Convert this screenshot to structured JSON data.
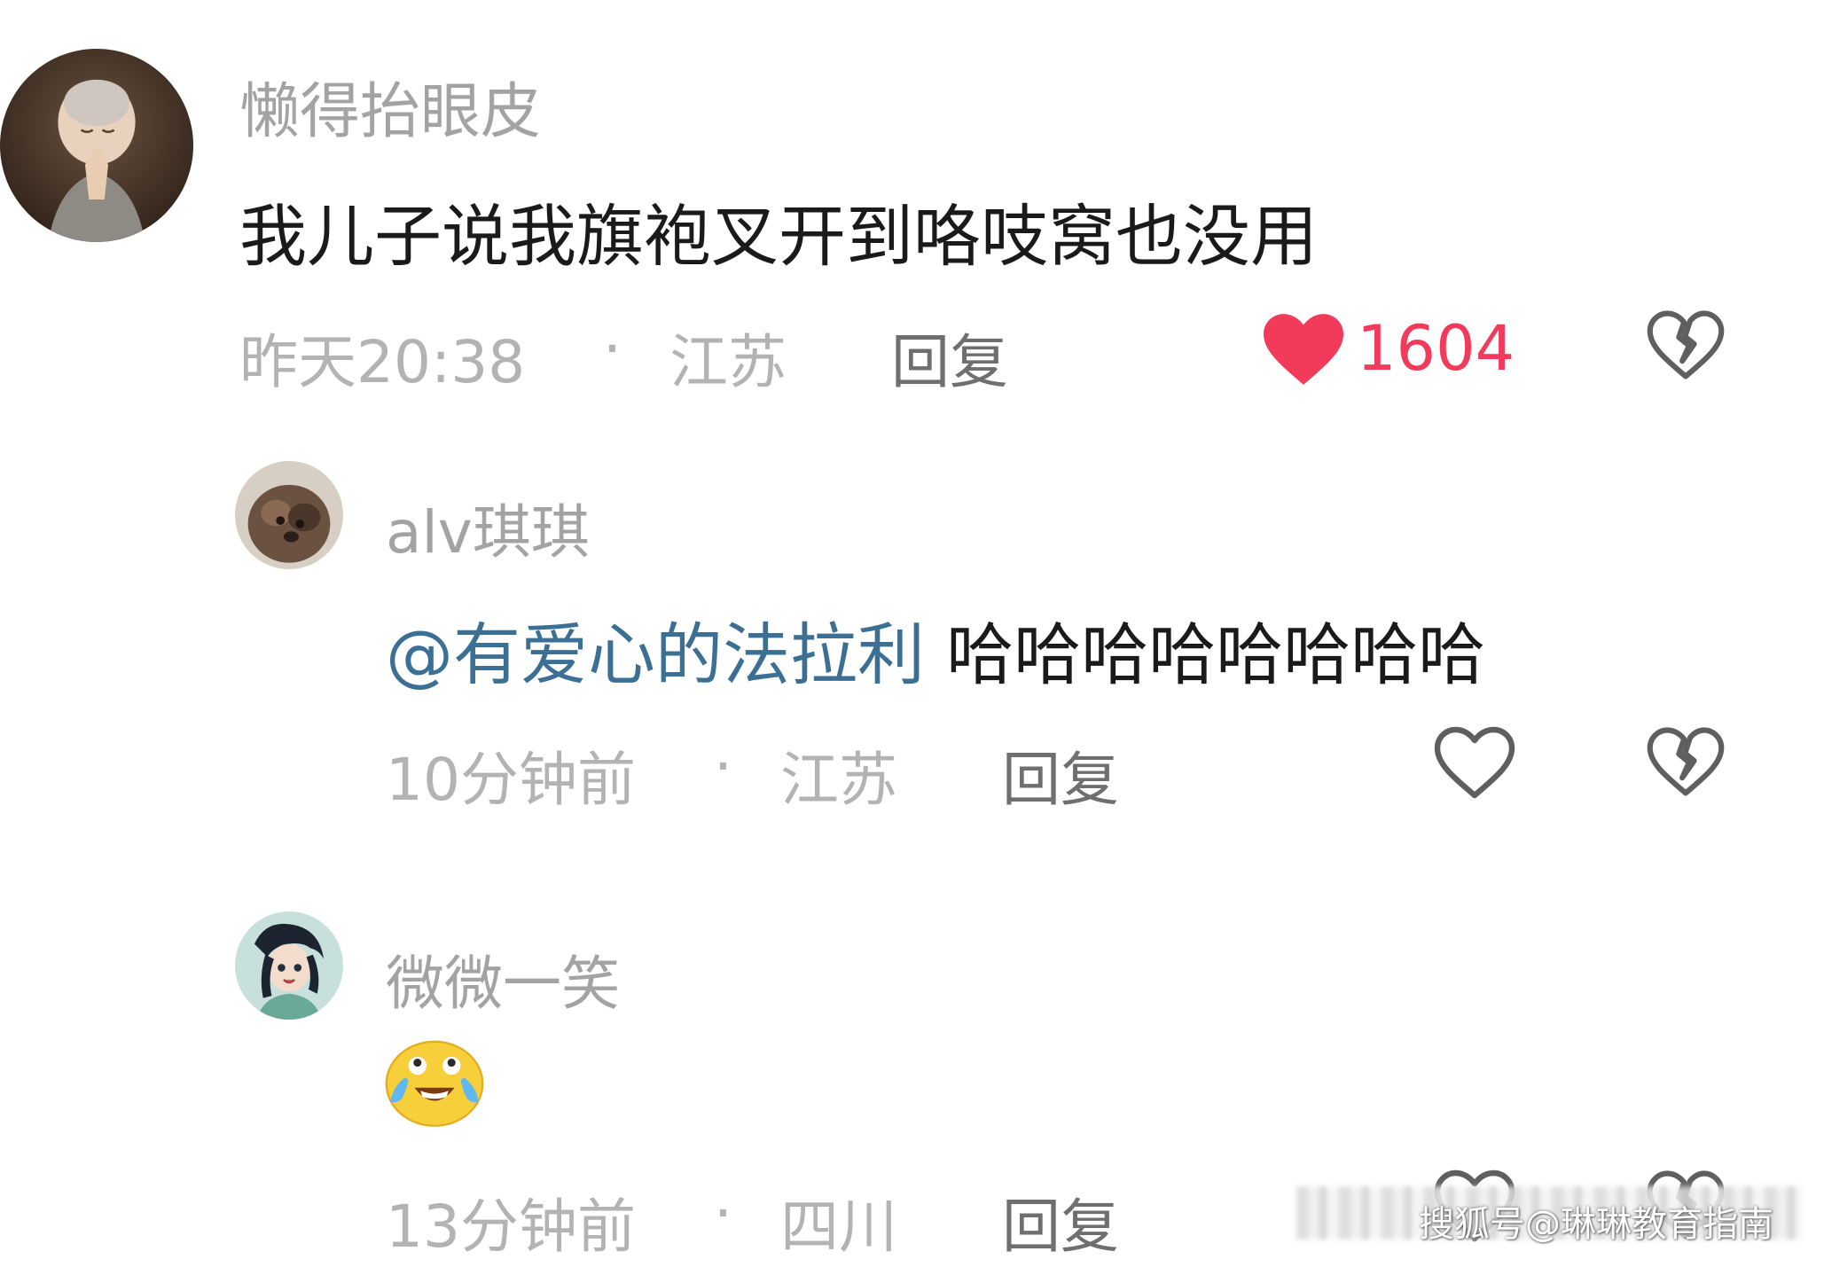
{
  "comments": [
    {
      "author": "懒得抬眼皮",
      "content": "我儿子说我旗袍叉开到咯吱窝也没用",
      "time": "昨天20:38",
      "separator": "·",
      "location": "江苏",
      "reply_label": "回复",
      "like_count": "1604",
      "liked": true
    },
    {
      "author": "alv琪琪",
      "mention": "@有爱心的法拉利",
      "content": "哈哈哈哈哈哈哈哈",
      "time": "10分钟前",
      "separator": "·",
      "location": "江苏",
      "reply_label": "回复",
      "liked": false
    },
    {
      "author": "微微一笑",
      "emoji": "laugh-cry-emoji",
      "time": "13分钟前",
      "separator": "·",
      "location": "四川",
      "reply_label": "回复",
      "liked": false
    }
  ],
  "watermark": "搜狐号@琳琳教育指南",
  "colors": {
    "like_red": "#f23a5b",
    "mention_blue": "#3c6f94",
    "name_gray": "#a3a3a3",
    "meta_gray": "#b3b3b3",
    "reply_gray": "#6f6f6f"
  },
  "icons": {
    "like_filled": "heart-filled-icon",
    "like_outline": "heart-outline-icon",
    "dislike": "broken-heart-icon"
  }
}
